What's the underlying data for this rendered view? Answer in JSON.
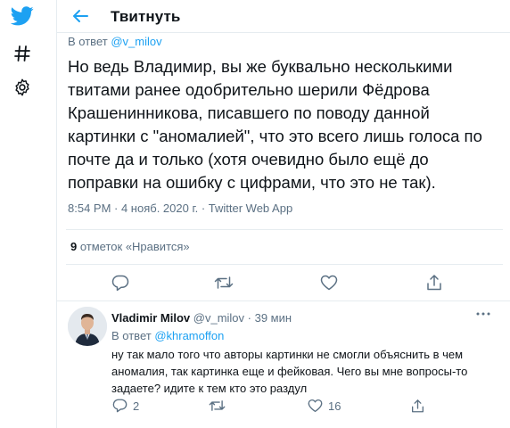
{
  "nav": {
    "icons": [
      "twitter-logo-icon",
      "hashtag-icon",
      "gear-icon"
    ],
    "brand_color": "#1da1f2"
  },
  "header": {
    "title": "Твитнуть"
  },
  "tweet": {
    "reply_prefix": "В ответ ",
    "reply_handle": "@v_milov",
    "text": "Но ведь Владимир, вы же буквально несколькими твитами ранее одобрительно шерили Фёдрова Крашенинникова, писавшего по поводу данной картинки с \"аномалией\", что это всего лишь голоса по почте да и только (хотя очевидно было ещё до поправки на ошибку с цифрами, что это не так).",
    "meta": "8:54 PM · 4 нояб. 2020 г. · Twitter Web App",
    "likes_count": "9",
    "likes_label": " отметок «Нравится»"
  },
  "reply": {
    "name": "Vladimir Milov",
    "handle": "@v_milov",
    "dot": " · ",
    "time": "39 мин",
    "reply_prefix": "В ответ ",
    "reply_handle": "@khramoffon",
    "text": "ну так мало того что авторы картинки не смогли объяснить в чем аномалия, так картинка еще и фейковая. Чего вы мне вопросы-то задаете? идите к тем кто это раздул",
    "reply_count": "2",
    "like_count": "16"
  }
}
